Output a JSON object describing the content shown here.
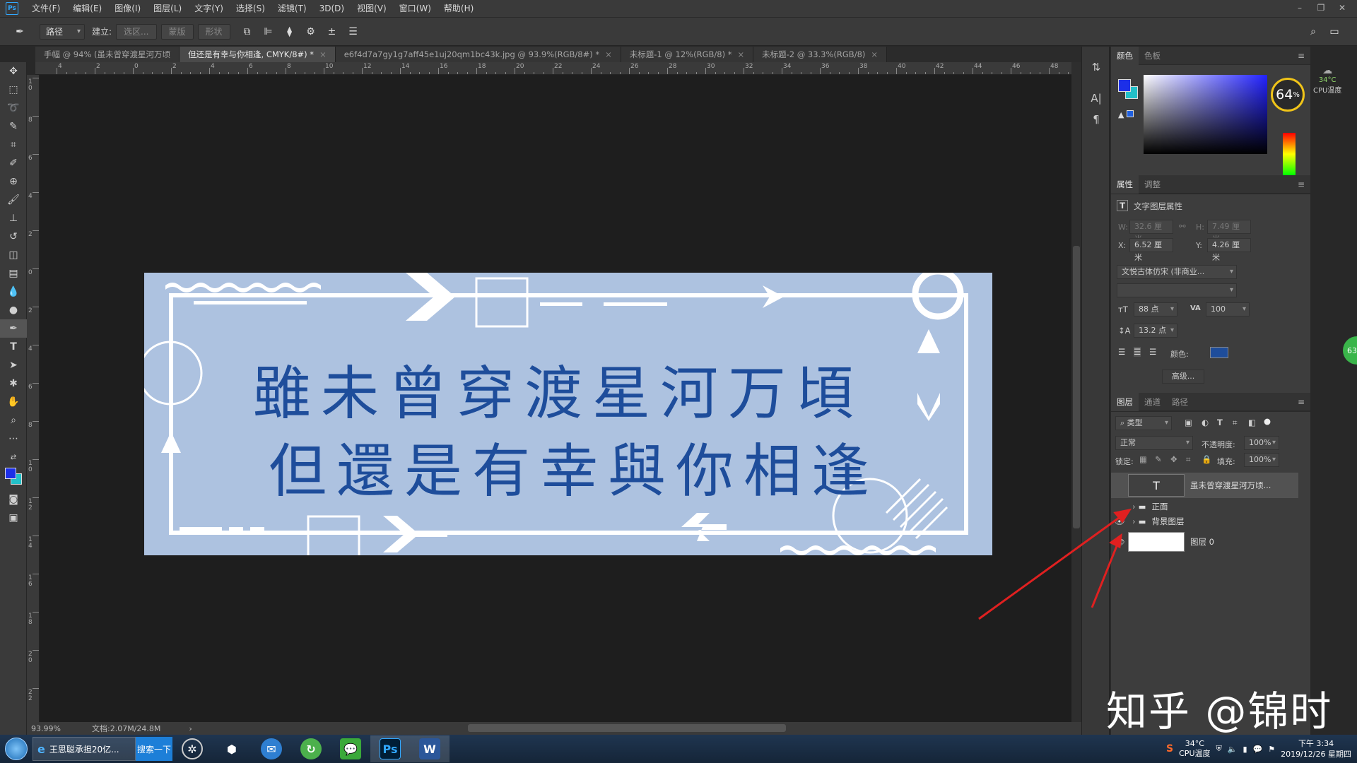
{
  "app": {
    "logo": "Ps"
  },
  "menu": [
    "文件(F)",
    "编辑(E)",
    "图像(I)",
    "图层(L)",
    "文字(Y)",
    "选择(S)",
    "滤镜(T)",
    "3D(D)",
    "视图(V)",
    "窗口(W)",
    "帮助(H)"
  ],
  "window_controls": [
    "–",
    "❐",
    "✕"
  ],
  "options": {
    "mode": "路径",
    "make_label": "建立:",
    "selection_btn": "选区...",
    "mask_btn": "蒙版",
    "shape_btn": "形状"
  },
  "tabs": [
    {
      "label": "手幅 @ 94% (虽未曾穿渡星河万顷",
      "active": false,
      "close": ""
    },
    {
      "label": "但还是有幸与你相逢, CMYK/8#) *",
      "active": true,
      "close": "×"
    },
    {
      "label": "e6f4d7a7gy1g7aff45e1uj20qm1bc43k.jpg @ 93.9%(RGB/8#) *",
      "active": false,
      "close": "×"
    },
    {
      "label": "未标题-1 @ 12%(RGB/8) *",
      "active": false,
      "close": "×"
    },
    {
      "label": "未标题-2 @ 33.3%(RGB/8)",
      "active": false,
      "close": "×"
    }
  ],
  "ruler_h": [
    "4",
    "2",
    "0",
    "2",
    "4",
    "6",
    "8",
    "10",
    "12",
    "14",
    "16",
    "18",
    "20",
    "22",
    "24",
    "26",
    "28",
    "30",
    "32",
    "34",
    "36",
    "38",
    "40",
    "42",
    "44",
    "46",
    "48"
  ],
  "ruler_v": [
    "1 0",
    "8",
    "6",
    "4",
    "2",
    "0",
    "2",
    "4",
    "6",
    "8",
    "1 0",
    "1 2",
    "1 4",
    "1 6",
    "1 8",
    "2 0",
    "2 2"
  ],
  "artwork": {
    "line1": "雖未曾穿渡星河万頃",
    "line2": "但還是有幸與你相逢",
    "bg_color": "#adc2e0",
    "text_color": "#1e4d9b"
  },
  "status": {
    "zoom": "93.99%",
    "doc": "文档:2.07M/24.8M"
  },
  "color_panel": {
    "tabs": [
      "颜色",
      "色板"
    ],
    "fg": "#1c2fe8",
    "bg": "#22c0c8",
    "gauge_value": "64",
    "gauge_unit": "%",
    "temp": "34°C",
    "temp_label": "CPU温度"
  },
  "props": {
    "tabs": [
      "属性",
      "调整"
    ],
    "header": "文字图层属性",
    "w_label": "W:",
    "w": "32.6 厘米",
    "h_label": "H:",
    "h": "7.49 厘米",
    "x_label": "X:",
    "x": "6.52 厘米",
    "y_label": "Y:",
    "y": "4.26 厘米",
    "font": "文悦古体仿宋 (非商业...",
    "size": "88 点",
    "tracking": "100",
    "leading": "13.2 点",
    "color_label": "颜色:",
    "text_color": "#1e4d9b",
    "advanced": "高级..."
  },
  "layers": {
    "tabs": [
      "图层",
      "通道",
      "路径"
    ],
    "filter": "类型",
    "blend": "正常",
    "opacity_label": "不透明度:",
    "opacity": "100%",
    "lock_label": "锁定:",
    "fill_label": "填充:",
    "fill": "100%",
    "items": [
      {
        "name": "虽未曾穿渡星河万顷...",
        "kind": "T"
      },
      {
        "name": "正面",
        "kind": "folder"
      },
      {
        "name": "背景图层",
        "kind": "folder"
      },
      {
        "name": "图层 0",
        "kind": "white"
      }
    ]
  },
  "watermark": "知乎 @锦时",
  "edge_badge": "63",
  "taskbar": {
    "ie_label": "王思聪承担20亿...",
    "search": "搜索一下",
    "apps": [
      "Ps",
      "W"
    ],
    "cpu_temp": "34°C",
    "cpu_label": "CPU温度",
    "time": "下午 3:34",
    "date": "2019/12/26 星期四"
  }
}
